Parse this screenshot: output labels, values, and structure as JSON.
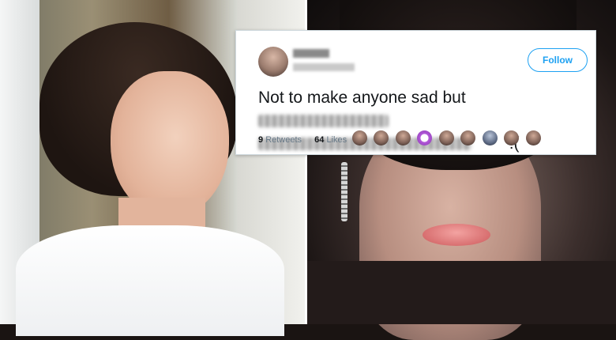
{
  "tweet": {
    "text_visible": "Not to make anyone sad but",
    "text_tail": ":(",
    "follow_label": "Follow",
    "retweets_count": "9",
    "retweets_label": "Retweets",
    "likes_count": "64",
    "likes_label": "Likes",
    "liker_avatars_count": 9
  },
  "colors": {
    "follow_accent": "#1da1f2",
    "text_primary": "#14171a",
    "text_secondary": "#657786"
  },
  "icons": [
    "avatar-icon",
    "liker-avatar-icon"
  ]
}
